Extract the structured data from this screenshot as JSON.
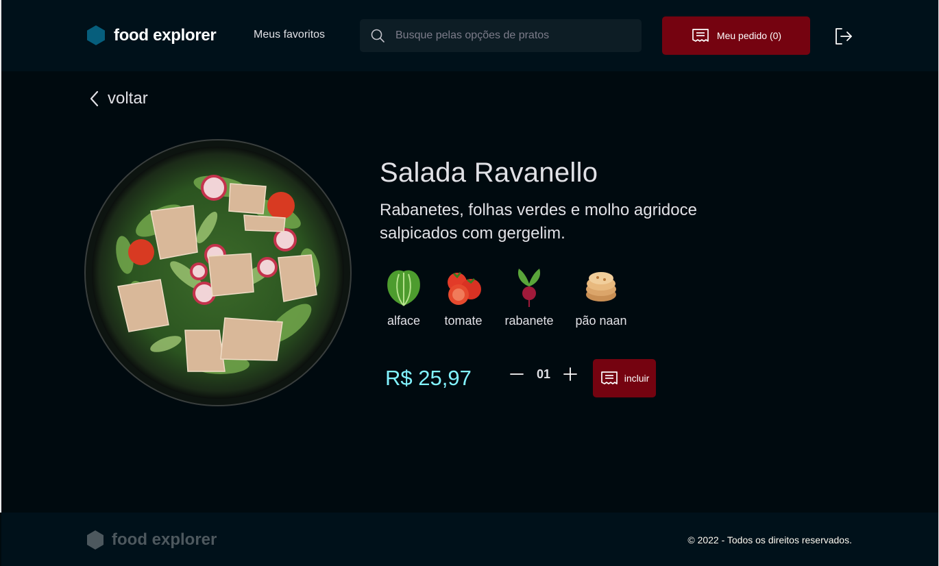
{
  "header": {
    "brand_name": "food explorer",
    "favorites_label": "Meus favoritos",
    "search_placeholder": "Busque pelas opções de pratos",
    "order_label": "Meu pedido (0)"
  },
  "back_label": "voltar",
  "dish": {
    "title": "Salada Ravanello",
    "description": "Rabanetes, folhas verdes e molho agridoce salpicados com gergelim.",
    "ingredients": [
      {
        "label": "alface",
        "icon": "lettuce-icon"
      },
      {
        "label": "tomate",
        "icon": "tomato-icon"
      },
      {
        "label": "rabanete",
        "icon": "radish-icon"
      },
      {
        "label": "pão naan",
        "icon": "naan-bread-icon"
      }
    ],
    "price": "R$ 25,97",
    "quantity": "01",
    "include_label": "incluir"
  },
  "footer": {
    "brand_name": "food explorer",
    "copyright": "© 2022 - Todos os direitos reservados."
  },
  "colors": {
    "accent_red": "#750310",
    "price_cyan": "#82F3FF",
    "brand_blue": "#065E7C"
  }
}
